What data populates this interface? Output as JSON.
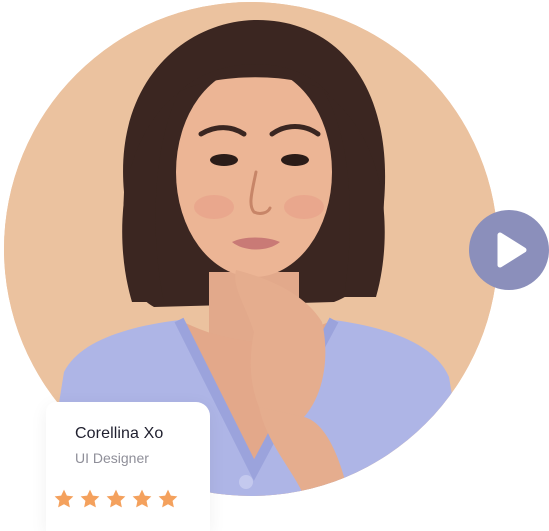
{
  "profile": {
    "name": "Corellina Xo",
    "role": "UI Designer",
    "rating": 5,
    "rating_max": 5
  },
  "colors": {
    "portrait_background": "#ebc29f",
    "play_button": "#8b8fbb",
    "star": "#f4a15d",
    "card_background": "#ffffff"
  },
  "icons": {
    "play": "play-icon",
    "star": "star-icon"
  }
}
